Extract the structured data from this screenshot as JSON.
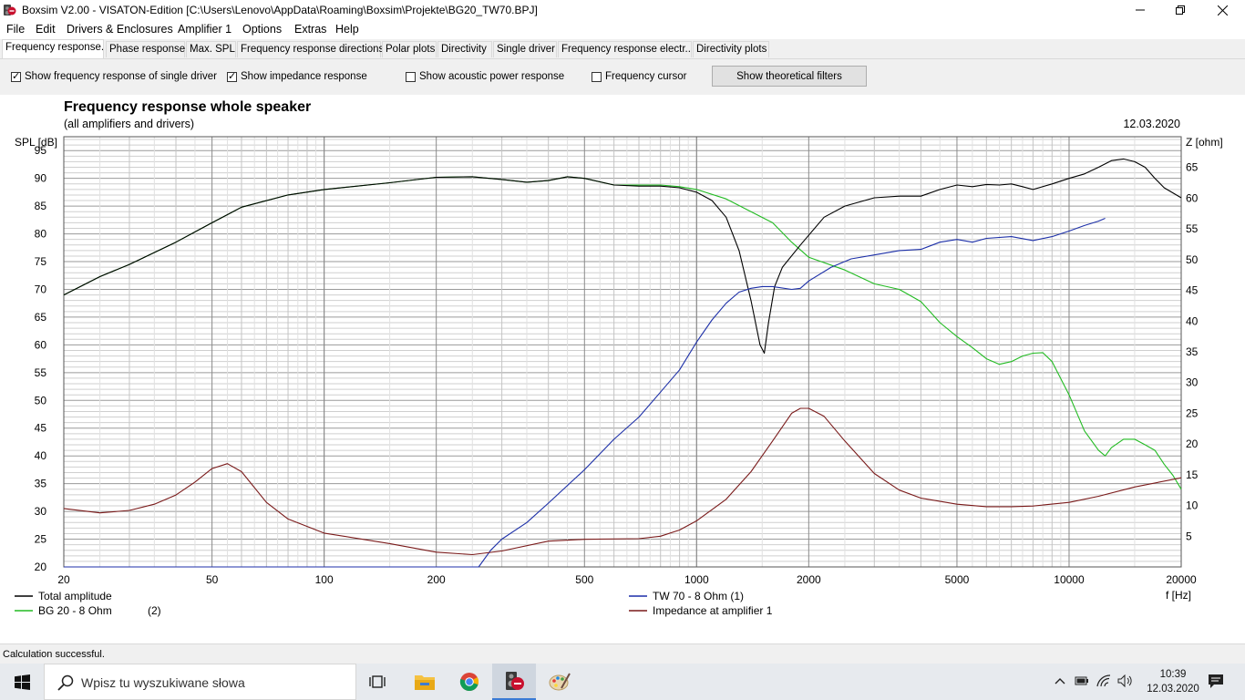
{
  "window": {
    "title": "Boxsim V2.00 - VISATON-Edition [C:\\Users\\Lenovo\\AppData\\Roaming\\Boxsim\\Projekte\\BG20_TW70.BPJ]",
    "minimize_icon": "minimize-icon",
    "maximize_icon": "restore-icon",
    "close_icon": "close-icon"
  },
  "menu": [
    "File",
    "Edit",
    "Drivers & Enclosures",
    "Amplifier 1",
    "Options",
    "Extras",
    "Help"
  ],
  "tabs": [
    "Frequency response.",
    "Phase response",
    "Max. SPL",
    "Frequency response directions",
    "Polar plots",
    "Directivity",
    "Single driver",
    "Frequency response electr..",
    "Directivity plots"
  ],
  "active_tab": "Frequency response.",
  "options": {
    "single_driver": {
      "label": "Show frequency response of single driver",
      "checked": true
    },
    "impedance": {
      "label": "Show impedance response",
      "checked": true
    },
    "acoustic_power": {
      "label": "Show acoustic power response",
      "checked": false
    },
    "cursor": {
      "label": "Frequency cursor",
      "checked": false
    },
    "filters_button": "Show theoretical filters"
  },
  "chart_data": {
    "type": "line",
    "title": "Frequency response whole speaker",
    "subtitle": "(all amplifiers and drivers)",
    "date": "12.03.2020",
    "xlabel": "f [Hz]",
    "ylabel": "SPL [dB]",
    "y2label": "Z [ohm]",
    "xscale": "log",
    "xlim": [
      20,
      20000
    ],
    "ylim": [
      20,
      97.5
    ],
    "y2lim": [
      0,
      70
    ],
    "xticks": [
      20,
      50,
      100,
      200,
      500,
      1000,
      2000,
      5000,
      10000,
      20000
    ],
    "xticklabels": [
      "20",
      "50",
      "100",
      "200",
      "500",
      "1000",
      "2000",
      "5000",
      "10000",
      "20000"
    ],
    "yticks": [
      20,
      25,
      30,
      35,
      40,
      45,
      50,
      55,
      60,
      65,
      70,
      75,
      80,
      85,
      90,
      95
    ],
    "y2ticks": [
      5,
      10,
      15,
      20,
      25,
      30,
      35,
      40,
      45,
      50,
      55,
      60,
      65
    ],
    "grid": true,
    "legend_placement": "bottom",
    "series": [
      {
        "name": "Total amplitude",
        "color": "#000000",
        "axis": "left",
        "points": [
          [
            20,
            69
          ],
          [
            25,
            72.3
          ],
          [
            30,
            74.5
          ],
          [
            40,
            78.5
          ],
          [
            50,
            82
          ],
          [
            60,
            84.8
          ],
          [
            80,
            87
          ],
          [
            100,
            88
          ],
          [
            150,
            89.2
          ],
          [
            200,
            90.2
          ],
          [
            250,
            90.3
          ],
          [
            300,
            89.8
          ],
          [
            350,
            89.3
          ],
          [
            400,
            89.6
          ],
          [
            450,
            90.3
          ],
          [
            500,
            90
          ],
          [
            600,
            88.8
          ],
          [
            700,
            88.6
          ],
          [
            800,
            88.6
          ],
          [
            900,
            88.3
          ],
          [
            1000,
            87.5
          ],
          [
            1100,
            86
          ],
          [
            1200,
            83
          ],
          [
            1300,
            77
          ],
          [
            1400,
            68
          ],
          [
            1480,
            60
          ],
          [
            1520,
            58.5
          ],
          [
            1560,
            64
          ],
          [
            1620,
            70.5
          ],
          [
            1700,
            74
          ],
          [
            1900,
            78
          ],
          [
            2200,
            83
          ],
          [
            2500,
            85
          ],
          [
            3000,
            86.5
          ],
          [
            3500,
            86.8
          ],
          [
            4000,
            86.8
          ],
          [
            4500,
            88
          ],
          [
            5000,
            88.8
          ],
          [
            5500,
            88.5
          ],
          [
            6000,
            88.9
          ],
          [
            6500,
            88.8
          ],
          [
            7000,
            89
          ],
          [
            7500,
            88.5
          ],
          [
            8000,
            88
          ],
          [
            9000,
            89
          ],
          [
            10000,
            90
          ],
          [
            11000,
            90.8
          ],
          [
            12000,
            92
          ],
          [
            13000,
            93.2
          ],
          [
            14000,
            93.5
          ],
          [
            15000,
            93
          ],
          [
            16000,
            92
          ],
          [
            17000,
            90
          ],
          [
            18000,
            88.3
          ],
          [
            20000,
            86.5
          ]
        ]
      },
      {
        "name": "BG 20 - 8 Ohm",
        "label_suffix": "(2)",
        "color": "#22bb22",
        "axis": "left",
        "points": [
          [
            20,
            69
          ],
          [
            25,
            72.3
          ],
          [
            30,
            74.5
          ],
          [
            40,
            78.5
          ],
          [
            50,
            82
          ],
          [
            60,
            84.8
          ],
          [
            80,
            87
          ],
          [
            100,
            88
          ],
          [
            150,
            89.2
          ],
          [
            200,
            90.2
          ],
          [
            250,
            90.3
          ],
          [
            300,
            89.8
          ],
          [
            350,
            89.3
          ],
          [
            400,
            89.6
          ],
          [
            450,
            90.3
          ],
          [
            500,
            90
          ],
          [
            600,
            88.8
          ],
          [
            700,
            88.8
          ],
          [
            800,
            88.8
          ],
          [
            900,
            88.5
          ],
          [
            1000,
            88
          ],
          [
            1200,
            86.3
          ],
          [
            1400,
            84
          ],
          [
            1600,
            82
          ],
          [
            1800,
            78.5
          ],
          [
            2000,
            75.8
          ],
          [
            2500,
            73.5
          ],
          [
            3000,
            71
          ],
          [
            3500,
            70
          ],
          [
            4000,
            67.8
          ],
          [
            4500,
            64
          ],
          [
            5000,
            61.5
          ],
          [
            5500,
            59.5
          ],
          [
            6000,
            57.5
          ],
          [
            6500,
            56.5
          ],
          [
            7000,
            57
          ],
          [
            7500,
            58
          ],
          [
            8000,
            58.5
          ],
          [
            8500,
            58.6
          ],
          [
            9000,
            57
          ],
          [
            10000,
            51
          ],
          [
            11000,
            44.5
          ],
          [
            12000,
            41
          ],
          [
            12500,
            40
          ],
          [
            13000,
            41.5
          ],
          [
            14000,
            43
          ],
          [
            15000,
            43
          ],
          [
            16000,
            42
          ],
          [
            17000,
            41
          ],
          [
            18000,
            38.5
          ],
          [
            19000,
            36.5
          ],
          [
            20000,
            34
          ]
        ]
      },
      {
        "name": "TW 70 - 8 Ohm (1)",
        "color": "#1c2fa8",
        "axis": "left",
        "points": [
          [
            20,
            20
          ],
          [
            240,
            20
          ],
          [
            260,
            20
          ],
          [
            280,
            23
          ],
          [
            300,
            25
          ],
          [
            350,
            28
          ],
          [
            400,
            31.5
          ],
          [
            500,
            37.5
          ],
          [
            600,
            43
          ],
          [
            700,
            47
          ],
          [
            800,
            51.5
          ],
          [
            900,
            55.5
          ],
          [
            1000,
            60.5
          ],
          [
            1100,
            64.5
          ],
          [
            1200,
            67.5
          ],
          [
            1300,
            69.5
          ],
          [
            1400,
            70.2
          ],
          [
            1500,
            70.5
          ],
          [
            1600,
            70.5
          ],
          [
            1800,
            70
          ],
          [
            1900,
            70.2
          ],
          [
            2000,
            71.5
          ],
          [
            2300,
            74
          ],
          [
            2600,
            75.5
          ],
          [
            3000,
            76.2
          ],
          [
            3500,
            77
          ],
          [
            4000,
            77.2
          ],
          [
            4500,
            78.5
          ],
          [
            5000,
            79
          ],
          [
            5500,
            78.5
          ],
          [
            6000,
            79.2
          ],
          [
            7000,
            79.5
          ],
          [
            8000,
            78.8
          ],
          [
            9000,
            79.5
          ],
          [
            10000,
            80.5
          ],
          [
            11000,
            81.5
          ],
          [
            12000,
            82.3
          ],
          [
            12500,
            82.8
          ]
        ]
      },
      {
        "name": "Impedance at amplifier 1",
        "color": "#7a1a1a",
        "axis": "right",
        "points": [
          [
            20,
            9.5
          ],
          [
            25,
            8.8
          ],
          [
            30,
            9.2
          ],
          [
            35,
            10.2
          ],
          [
            40,
            11.7
          ],
          [
            45,
            13.8
          ],
          [
            50,
            16
          ],
          [
            55,
            16.8
          ],
          [
            60,
            15.5
          ],
          [
            70,
            10.5
          ],
          [
            80,
            7.8
          ],
          [
            100,
            5.5
          ],
          [
            150,
            3.8
          ],
          [
            200,
            2.4
          ],
          [
            250,
            2
          ],
          [
            300,
            2.6
          ],
          [
            400,
            4.2
          ],
          [
            500,
            4.5
          ],
          [
            700,
            4.6
          ],
          [
            800,
            5
          ],
          [
            900,
            6
          ],
          [
            1000,
            7.5
          ],
          [
            1200,
            11
          ],
          [
            1400,
            15.5
          ],
          [
            1600,
            20.5
          ],
          [
            1800,
            25
          ],
          [
            1900,
            25.8
          ],
          [
            2000,
            25.8
          ],
          [
            2200,
            24.5
          ],
          [
            2500,
            20.5
          ],
          [
            3000,
            15.2
          ],
          [
            3500,
            12.5
          ],
          [
            4000,
            11.2
          ],
          [
            5000,
            10.2
          ],
          [
            6000,
            9.8
          ],
          [
            7000,
            9.8
          ],
          [
            8000,
            9.9
          ],
          [
            10000,
            10.5
          ],
          [
            12000,
            11.5
          ],
          [
            15000,
            13
          ],
          [
            20000,
            14.5
          ]
        ]
      }
    ]
  },
  "status": "Calculation successful.",
  "taskbar": {
    "search_placeholder": "Wpisz tu wyszukiwane słowa",
    "time": "10:39",
    "date": "12.03.2020",
    "icons": [
      "windows-start-icon",
      "task-view-icon",
      "file-explorer-icon",
      "chrome-icon",
      "boxsim-icon",
      "paint-icon"
    ],
    "tray_icons": [
      "chevron-up-icon",
      "battery-icon",
      "wifi-icon",
      "volume-icon"
    ],
    "notification_icon": "notification-icon"
  }
}
